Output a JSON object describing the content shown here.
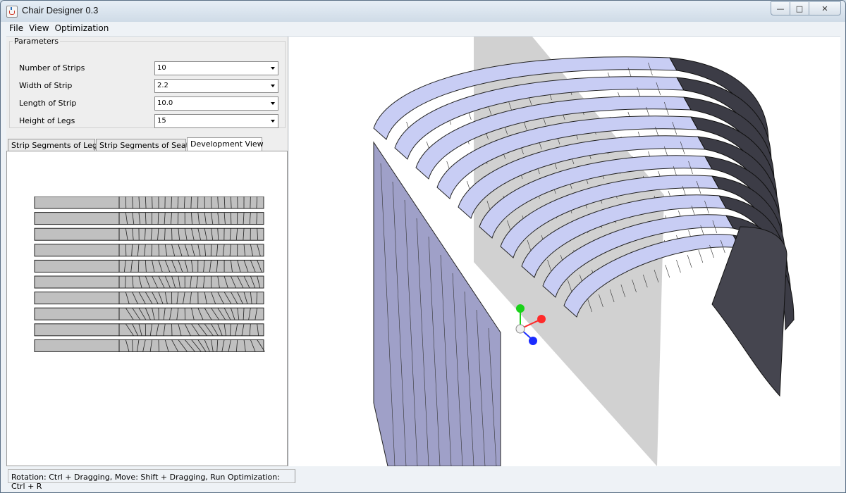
{
  "window": {
    "title": "Chair Designer 0.3",
    "buttons": {
      "minimize": "—",
      "maximize": "□",
      "close": "✕"
    }
  },
  "menu": [
    "File",
    "View",
    "Optimization"
  ],
  "parameters": {
    "legend": "Parameters",
    "rows": [
      {
        "label": "Number of Strips",
        "value": "10"
      },
      {
        "label": "Width of Strip",
        "value": "2.2"
      },
      {
        "label": "Length of Strip",
        "value": "10.0"
      },
      {
        "label": "Height of Legs",
        "value": "15"
      }
    ]
  },
  "tabs": [
    {
      "label": "Strip Segments of Leg",
      "active": false
    },
    {
      "label": "Strip Segments of Seat",
      "active": false
    },
    {
      "label": "Development View",
      "active": true
    }
  ],
  "development_view": {
    "strip_count": 10
  },
  "status": "Rotation: Ctrl + Dragging, Move: Shift + Dragging, Run Optimization: Ctrl + R",
  "colors": {
    "strip_light": "#c8cdf4",
    "strip_dark": "#3c3c46",
    "plane": "#bdbdbd",
    "dev_fill": "#c0c0c0",
    "axis_x": "#ff2a2a",
    "axis_y": "#19d219",
    "axis_z": "#1a2bff"
  }
}
